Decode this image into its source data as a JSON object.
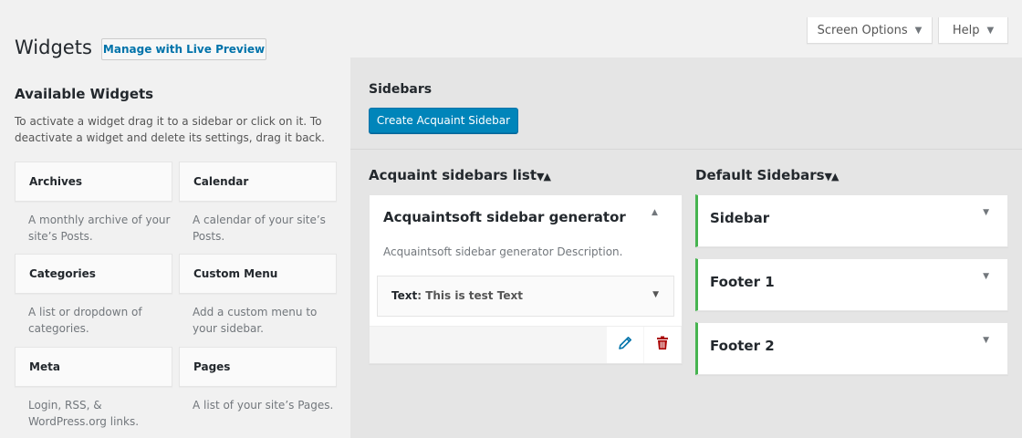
{
  "screen_meta": {
    "screen_options": "Screen Options",
    "help": "Help",
    "caret": "▼"
  },
  "header": {
    "title": "Widgets",
    "live_preview": "Manage with Live Preview"
  },
  "available": {
    "title": "Available Widgets",
    "description": "To activate a widget drag it to a sidebar or click on it. To deactivate a widget and delete its settings, drag it back.",
    "widgets": [
      {
        "name": "Archives",
        "desc": "A monthly archive of your site’s Posts."
      },
      {
        "name": "Calendar",
        "desc": "A calendar of your site’s Posts."
      },
      {
        "name": "Categories",
        "desc": "A list or dropdown of categories."
      },
      {
        "name": "Custom Menu",
        "desc": "Add a custom menu to your sidebar."
      },
      {
        "name": "Meta",
        "desc": "Login, RSS, & WordPress.org links."
      },
      {
        "name": "Pages",
        "desc": "A list of your site’s Pages."
      }
    ]
  },
  "sidebars": {
    "title": "Sidebars",
    "create_button": "Create Acquaint Sidebar",
    "sorter": "▼▲",
    "acquaint_list": {
      "title": "Acquaint sidebars list",
      "name": "Acquaintsoft sidebar generator",
      "toggle": "▲",
      "description": "Acquaintsoft sidebar generator Description.",
      "text_widget": {
        "label": "Text",
        "value": ": This is test Text",
        "caret": "▼"
      }
    },
    "default": {
      "title": "Default Sidebars",
      "items": [
        {
          "label": "Sidebar",
          "caret": "▼"
        },
        {
          "label": "Footer 1",
          "caret": "▼"
        },
        {
          "label": "Footer 2",
          "caret": "▼"
        }
      ]
    }
  },
  "colors": {
    "accent": "#0085ba",
    "active_border": "#46b450",
    "delete": "#a00",
    "edit": "#0073aa"
  }
}
